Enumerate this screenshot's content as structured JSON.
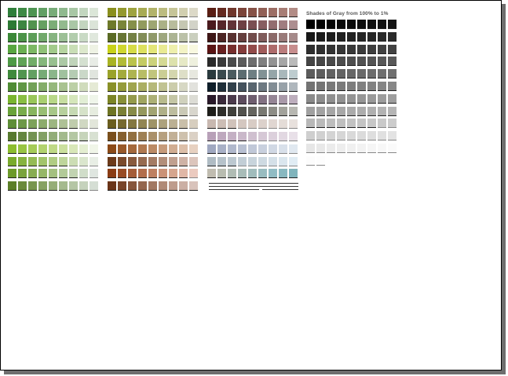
{
  "gray_panel": {
    "title": "Shades of Gray from 100% to 1%"
  },
  "palettes": [
    {
      "name": "greens",
      "rows": [
        [
          "#2f7f3b",
          "#3e8a45",
          "#4e9552",
          "#62a065",
          "#78ac79",
          "#8fb98e",
          "#a8c7a5",
          "#c2d6bf",
          "#dbe6d8"
        ],
        [
          "#2d7a35",
          "#3d8642",
          "#51934f",
          "#66a062",
          "#7cad77",
          "#93ba8e",
          "#aac7a6",
          "#c3d5bf",
          "#dbe4d8"
        ],
        [
          "#3a8837",
          "#4b9347",
          "#5d9e58",
          "#71a96b",
          "#86b480",
          "#9cc096",
          "#b2cdad",
          "#c9dac5",
          "#e0e8dd"
        ],
        [
          "#58a640",
          "#6aaf52",
          "#7cb864",
          "#8fc177",
          "#a2ca8b",
          "#b6d4a0",
          "#c9deb6",
          "#dce8cc",
          "#eef2e4"
        ],
        [
          "#4e9a46",
          "#60a357",
          "#72ad69",
          "#85b77c",
          "#98c090",
          "#acc9a5",
          "#c0d4ba",
          "#d4e0d0",
          "#e8ece6"
        ],
        [
          "#3f8a3c",
          "#519550",
          "#63a062",
          "#77ab76",
          "#8bb68a",
          "#a0c19e",
          "#b5ccb3",
          "#cad8c8",
          "#e0e5de"
        ],
        [
          "#4f8c35",
          "#609745",
          "#72a257",
          "#84ad69",
          "#96b87c",
          "#a9c390",
          "#bcd0a6",
          "#d0dcbc",
          "#e5ead5"
        ],
        [
          "#7ab52f",
          "#89be43",
          "#99c659",
          "#a9cf70",
          "#b8d788",
          "#c7dea1",
          "#d5e6bb",
          "#e2eed5",
          "#eff5ea"
        ],
        [
          "#6aa33a",
          "#79ac4c",
          "#88b55f",
          "#98be73",
          "#a7c788",
          "#b7d09d",
          "#c6d9b3",
          "#d6e2c9",
          "#e6ecdf"
        ],
        [
          "#5e8e37",
          "#6d9848",
          "#7da25a",
          "#8dac6d",
          "#9db681",
          "#aec196",
          "#bfccac",
          "#d0d8c2",
          "#e2e6da"
        ],
        [
          "#577a2f",
          "#648640",
          "#739352",
          "#82a064",
          "#92ad78",
          "#a3ba8d",
          "#b4c7a3",
          "#c6d4ba",
          "#d8e1d2"
        ],
        [
          "#8cbd2f",
          "#98c443",
          "#a5cb58",
          "#b2d26e",
          "#bfd986",
          "#cbe09e",
          "#d8e7b8",
          "#e4eed1",
          "#f0f5e8"
        ],
        [
          "#7aab2d",
          "#87b340",
          "#95bb55",
          "#a2c46b",
          "#b0cc83",
          "#bed59b",
          "#ccddb4",
          "#dae6cd",
          "#e8eee5"
        ],
        [
          "#6d9a2a",
          "#7aa33d",
          "#88ad52",
          "#96b768",
          "#a4c080",
          "#b2ca98",
          "#c1d3b1",
          "#d0ddc9",
          "#dfe6e0"
        ],
        [
          "#5c7f28",
          "#6a8a3a",
          "#78964e",
          "#87a262",
          "#96ae78",
          "#a5ba8e",
          "#b5c6a5",
          "#c5d2bc",
          "#d5ded4"
        ]
      ]
    },
    {
      "name": "olives",
      "rows": [
        [
          "#8a8f1e",
          "#94992f",
          "#9ea340",
          "#a8ab54",
          "#b2b36a",
          "#bcbc80",
          "#c6c598",
          "#d1cfb0",
          "#dcd9c8"
        ],
        [
          "#6e7a2a",
          "#7a853a",
          "#86904b",
          "#929b5e",
          "#9ea672",
          "#abb187",
          "#b8bc9c",
          "#c5c7b2",
          "#d2d3c8"
        ],
        [
          "#5a6a24",
          "#677534",
          "#748145",
          "#828d57",
          "#909a6a",
          "#9ea77e",
          "#acb493",
          "#bbc1a8",
          "#cacfbe"
        ],
        [
          "#c8d11a",
          "#cfd630",
          "#d6db47",
          "#dde05f",
          "#e3e578",
          "#e9ea92",
          "#eeefac",
          "#f3f3c6",
          "#f8f8e0"
        ],
        [
          "#a9b324",
          "#b2bb37",
          "#bbc34c",
          "#c4cb63",
          "#ccd27b",
          "#d5da94",
          "#dde2ad",
          "#e6e9c6",
          "#eef0de"
        ],
        [
          "#9aa22a",
          "#a4ab3c",
          "#aeb450",
          "#b8bd66",
          "#c1c57d",
          "#cbce95",
          "#d4d6ae",
          "#dedfc7",
          "#e7e8df"
        ],
        [
          "#8a9128",
          "#959b3a",
          "#a0a54e",
          "#abaf63",
          "#b6b97a",
          "#c1c392",
          "#cccdab",
          "#d7d8c4",
          "#e2e2dd"
        ],
        [
          "#7c8426",
          "#888f38",
          "#949a4b",
          "#a0a560",
          "#acb076",
          "#b8bb8d",
          "#c4c6a5",
          "#d0d1bd",
          "#dcdcd5"
        ],
        [
          "#6e7424",
          "#7b8036",
          "#888c49",
          "#95985d",
          "#a2a472",
          "#afb088",
          "#bdbd9f",
          "#cac9b6",
          "#d8d6cd"
        ],
        [
          "#6a5d1e",
          "#776a2f",
          "#847841",
          "#928654",
          "#9f9468",
          "#ada27d",
          "#bbb093",
          "#c9bfa9",
          "#d7cebf"
        ],
        [
          "#7a4f1c",
          "#86602e",
          "#927040",
          "#9e8054",
          "#aa9069",
          "#b6a07f",
          "#c2b096",
          "#cec1ad",
          "#dbd1c5"
        ],
        [
          "#8b4a18",
          "#98592a",
          "#a4693d",
          "#b07950",
          "#bb8a65",
          "#c69b7b",
          "#d1ad92",
          "#dcbfa9",
          "#e7d1c1"
        ],
        [
          "#6c3a1a",
          "#7a4a2b",
          "#885a3d",
          "#966b50",
          "#a47c64",
          "#b28e79",
          "#c0a08f",
          "#ceb2a5",
          "#dcc5bc"
        ],
        [
          "#8a3c14",
          "#984c25",
          "#a55d38",
          "#b26e4c",
          "#be8061",
          "#ca9277",
          "#d5a58e",
          "#e0b7a6",
          "#ebcabf"
        ],
        [
          "#6a3418",
          "#784429",
          "#86553b",
          "#94664e",
          "#a27862",
          "#b08a77",
          "#be9c8d",
          "#cbafa4",
          "#d9c3bb"
        ]
      ]
    },
    {
      "name": "browns-blues",
      "rows": [
        [
          "#5a1e14",
          "#652a20",
          "#70372c",
          "#7b4439",
          "#865247",
          "#916056",
          "#9c6e65",
          "#a77d75",
          "#b28c86"
        ],
        [
          "#4a1a1e",
          "#56262a",
          "#623337",
          "#6e4144",
          "#7a4f52",
          "#875e61",
          "#936d70",
          "#a07d80",
          "#ad8e90"
        ],
        [
          "#3e1616",
          "#4b2322",
          "#58302f",
          "#653e3d",
          "#724c4b",
          "#7f5b5a",
          "#8c6a69",
          "#997a79",
          "#a68a8a"
        ],
        [
          "#5a1414",
          "#682020",
          "#762e2d",
          "#843c3b",
          "#924b4a",
          "#a05b5a",
          "#ad6b6b",
          "#ba7c7c",
          "#c78e8e"
        ],
        [
          "#2a2a2a",
          "#3a3a3a",
          "#4b4b4b",
          "#5c5c5c",
          "#6e6e6e",
          "#808080",
          "#939393",
          "#a6a6a6",
          "#bababa"
        ],
        [
          "#2a3a3e",
          "#3a4a4e",
          "#4b5b5f",
          "#5d6d71",
          "#6f7f83",
          "#829295",
          "#95a5a8",
          "#a9b8bb",
          "#bdcccf"
        ],
        [
          "#0e1e2a",
          "#1f2f3a",
          "#31404b",
          "#44525d",
          "#58656f",
          "#6d7982",
          "#828d95",
          "#98a2a9",
          "#afb7bd"
        ],
        [
          "#2a1a2a",
          "#3a2a3a",
          "#4b3a4b",
          "#5d4c5d",
          "#6f5e6f",
          "#827182",
          "#958595",
          "#a999a9",
          "#bdaebd"
        ],
        [
          "#1e1e1a",
          "#2e2e2a",
          "#40403b",
          "#52524d",
          "#65655f",
          "#797972",
          "#8d8d86",
          "#a2a29b",
          "#b7b7b1"
        ],
        [
          "#c8b8b0",
          "#ccbdb5",
          "#d0c2ba",
          "#d4c7c0",
          "#d8ccc5",
          "#dcd1cb",
          "#e0d6d1",
          "#e4dcd7",
          "#e8e1dd"
        ],
        [
          "#b8a0b8",
          "#bea8be",
          "#c4b0c4",
          "#cab8ca",
          "#d0c0d0",
          "#d6c8d6",
          "#dcd0dc",
          "#e2d8e2",
          "#e8e0e8"
        ],
        [
          "#a0a8c0",
          "#a8b0c6",
          "#b0b8cc",
          "#b8c0d2",
          "#c0c8d8",
          "#c8d0de",
          "#d0d8e4",
          "#d8e0ea",
          "#e0e8f0"
        ],
        [
          "#b0bcc4",
          "#b6c2ca",
          "#bcc8d0",
          "#c2ced6",
          "#c8d4dc",
          "#cedae2",
          "#d4e0e8",
          "#dae6ee",
          "#e0ecf4"
        ],
        [
          "#c0bcb0",
          "#b8bcb0",
          "#b0bcb4",
          "#a8bcb8",
          "#a0bcbc",
          "#98bcc0",
          "#90bcc4",
          "#88b8c0",
          "#80b4bc"
        ]
      ]
    },
    {
      "name": "grays",
      "rows": [
        [
          "#000000",
          "#030303",
          "#050505",
          "#080808",
          "#0a0a0a",
          "#0d0d0d",
          "#0f0f0f",
          "#121212",
          "#141414"
        ],
        [
          "#171717",
          "#1a1a1a",
          "#1c1c1c",
          "#1f1f1f",
          "#212121",
          "#242424",
          "#262626",
          "#292929",
          "#2b2b2b"
        ],
        [
          "#2e2e2e",
          "#303030",
          "#333333",
          "#363636",
          "#383838",
          "#3b3b3b",
          "#3d3d3d",
          "#404040",
          "#424242"
        ],
        [
          "#454545",
          "#474747",
          "#4a4a4a",
          "#4d4d4d",
          "#4f4f4f",
          "#525252",
          "#545454",
          "#575757",
          "#595959"
        ],
        [
          "#5c5c5c",
          "#5e5e5e",
          "#616161",
          "#636363",
          "#666666",
          "#696969",
          "#6b6b6b",
          "#6e6e6e",
          "#707070"
        ],
        [
          "#737373",
          "#757575",
          "#787878",
          "#7a7a7a",
          "#7d7d7d",
          "#808080",
          "#828282",
          "#858585",
          "#878787"
        ],
        [
          "#8a8a8a",
          "#8c8c8c",
          "#8f8f8f",
          "#919191",
          "#949494",
          "#969696",
          "#999999",
          "#9c9c9c",
          "#9e9e9e"
        ],
        [
          "#a1a1a1",
          "#a3a3a3",
          "#a6a6a6",
          "#a8a8a8",
          "#ababab",
          "#adadad",
          "#b0b0b0",
          "#b3b3b3",
          "#b5b5b5"
        ],
        [
          "#b8b8b8",
          "#bababa",
          "#bdbdbd",
          "#bfbfbf",
          "#c2c2c2",
          "#c4c4c4",
          "#c7c7c7",
          "#c9c9c9",
          "#cccccc"
        ],
        [
          "#cfcfcf",
          "#d1d1d1",
          "#d4d4d4",
          "#d6d6d6",
          "#d9d9d9",
          "#dbdbdb",
          "#dedede",
          "#e0e0e0",
          "#e3e3e3"
        ],
        [
          "#e6e6e6",
          "#e8e8e8",
          "#ebebeb",
          "#ededed",
          "#f0f0f0",
          "#f2f2f2",
          "#f5f5f5",
          "#f7f7f7",
          "#fafafa"
        ],
        [
          "#fcfcfc",
          "#fdfdfd"
        ]
      ]
    }
  ]
}
